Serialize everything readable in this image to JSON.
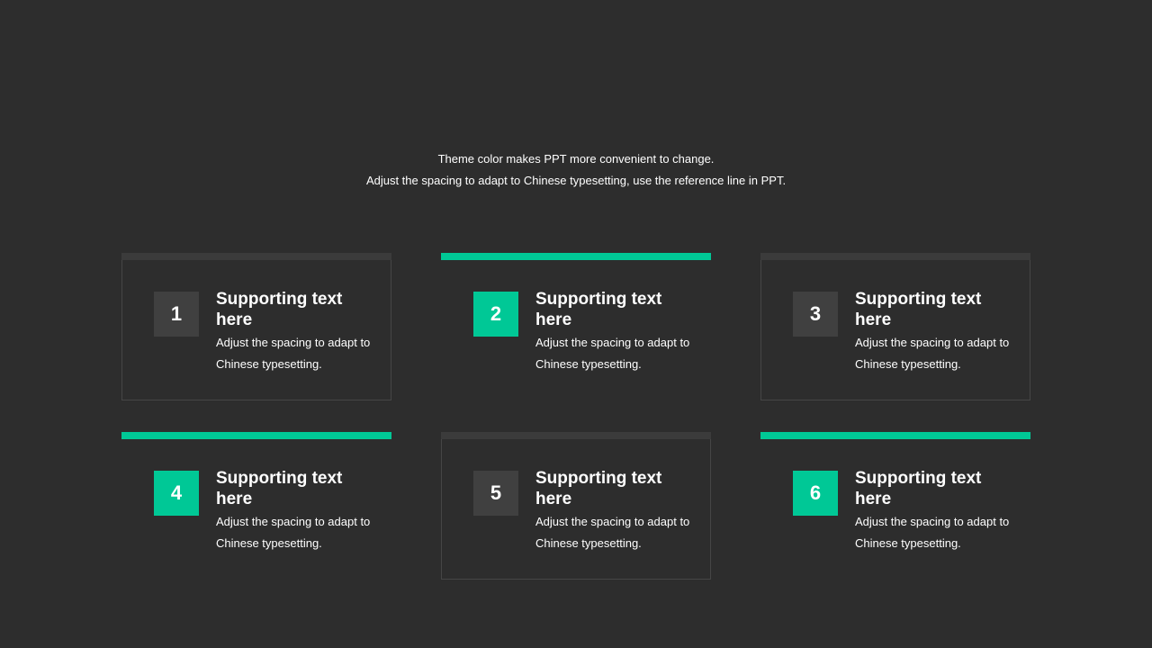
{
  "subtitle": {
    "line1": "Theme color makes PPT more convenient to change.",
    "line2": "Adjust the spacing to adapt to Chinese typesetting, use the reference line in PPT."
  },
  "cards": [
    {
      "number": "1",
      "heading": "Supporting text here",
      "body": "Adjust the spacing to adapt to Chinese typesetting."
    },
    {
      "number": "2",
      "heading": "Supporting text here",
      "body": "Adjust the spacing to adapt to Chinese typesetting."
    },
    {
      "number": "3",
      "heading": "Supporting text here",
      "body": "Adjust the spacing to adapt to Chinese typesetting."
    },
    {
      "number": "4",
      "heading": "Supporting text here",
      "body": "Adjust the spacing to adapt to Chinese typesetting."
    },
    {
      "number": "5",
      "heading": "Supporting text here",
      "body": "Adjust the spacing to adapt to Chinese typesetting."
    },
    {
      "number": "6",
      "heading": "Supporting text here",
      "body": "Adjust the spacing to adapt to Chinese typesetting."
    }
  ],
  "colors": {
    "background": "#2d2d2d",
    "accent": "#00c896",
    "muted_box": "#404040",
    "border": "#464646"
  }
}
